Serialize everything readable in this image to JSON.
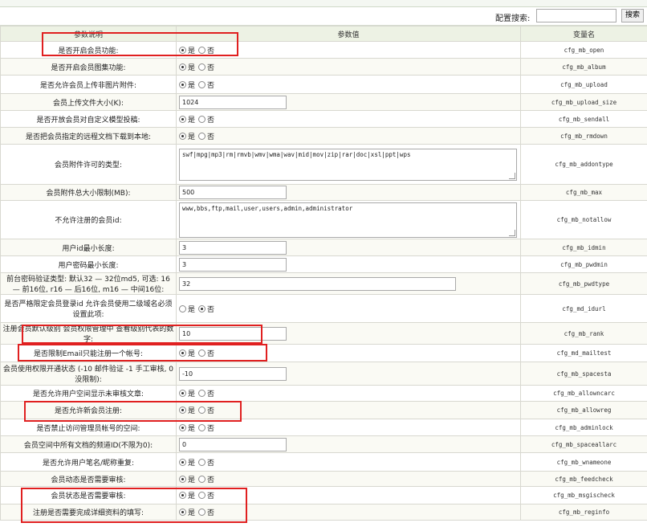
{
  "search": {
    "label": "配置搜索:",
    "value": "",
    "button": "搜索"
  },
  "columns": {
    "desc": "参数说明",
    "value": "参数值",
    "name": "变量名"
  },
  "radio_labels": {
    "yes": "是",
    "no": "否"
  },
  "rows": [
    {
      "desc": "是否开启会员功能:",
      "type": "radio",
      "value": "yes",
      "var": "cfg_mb_open"
    },
    {
      "desc": "是否开启会员图集功能:",
      "type": "radio",
      "value": "yes",
      "var": "cfg_mb_album"
    },
    {
      "desc": "是否允许会员上传非图片附件:",
      "type": "radio",
      "value": "yes",
      "var": "cfg_mb_upload"
    },
    {
      "desc": "会员上传文件大小(K):",
      "type": "text",
      "value": "1024",
      "var": "cfg_mb_upload_size"
    },
    {
      "desc": "是否开放会员对自定义模型投稿:",
      "type": "radio",
      "value": "yes",
      "var": "cfg_mb_sendall"
    },
    {
      "desc": "是否把会员指定的远程文档下载到本地:",
      "type": "radio",
      "value": "yes",
      "var": "cfg_mb_rmdown"
    },
    {
      "desc": "会员附件许可的类型:",
      "type": "textarea",
      "value": "swf|mpg|mp3|rm|rmvb|wmv|wma|wav|mid|mov|zip|rar|doc|xsl|ppt|wps",
      "var": "cfg_mb_addontype"
    },
    {
      "desc": "会员附件总大小限制(MB):",
      "type": "text",
      "value": "500",
      "var": "cfg_mb_max"
    },
    {
      "desc": "不允许注册的会员id:",
      "type": "textarea",
      "value": "www,bbs,ftp,mail,user,users,admin,administrator",
      "var": "cfg_mb_notallow"
    },
    {
      "desc": "用户id最小长度:",
      "type": "text",
      "value": "3",
      "var": "cfg_mb_idmin"
    },
    {
      "desc": "用户密码最小长度:",
      "type": "text",
      "value": "3",
      "var": "cfg_mb_pwdmin"
    },
    {
      "desc": "前台密码验证类型: 默认32 — 32位md5, 可选: 16 — 前16位, r16 — 后16位, m16 — 中间16位:",
      "type": "textwide",
      "value": "32",
      "var": "cfg_mb_pwdtype"
    },
    {
      "desc": "是否严格限定会员登录id 允许会员使用二级域名必须设置此项:",
      "type": "radio",
      "value": "no",
      "var": "cfg_md_idurl"
    },
    {
      "desc": "注册会员默认级别 会员权限管理中 查看级别代表的数字:",
      "type": "text",
      "value": "10",
      "var": "cfg_mb_rank"
    },
    {
      "desc": "是否限制Email只能注册一个帐号:",
      "type": "radio",
      "value": "yes",
      "var": "cfg_md_mailtest"
    },
    {
      "desc": "会员使用权限开通状态 (-10 邮件验证 -1 手工审核, 0 没限制):",
      "type": "text",
      "value": "-10",
      "var": "cfg_mb_spacesta"
    },
    {
      "desc": "是否允许用户空间显示未审核文章:",
      "type": "radio",
      "value": "yes",
      "var": "cfg_mb_allowncarc"
    },
    {
      "desc": "是否允许新会员注册:",
      "type": "radio",
      "value": "yes",
      "var": "cfg_mb_allowreg"
    },
    {
      "desc": "是否禁止访问管理员帐号的空间:",
      "type": "radio",
      "value": "yes",
      "var": "cfg_mb_adminlock"
    },
    {
      "desc": "会员空间中所有文档的频道ID(不限为0):",
      "type": "text",
      "value": "0",
      "var": "cfg_mb_spaceallarc"
    },
    {
      "desc": "是否允许用户笔名/昵称重复:",
      "type": "radio",
      "value": "yes",
      "var": "cfg_mb_wnameone"
    },
    {
      "desc": "会员动态是否需要审核:",
      "type": "radio",
      "value": "yes",
      "var": "cfg_mb_feedcheck"
    },
    {
      "desc": "会员状态是否需要审核:",
      "type": "radio",
      "value": "yes",
      "var": "cfg_mb_msgischeck"
    },
    {
      "desc": "注册是否需要完成详细资料的填写:",
      "type": "radio",
      "value": "yes",
      "var": "cfg_mb_reginfo"
    }
  ],
  "colors": {
    "header_bg": "#edf2e4",
    "border": "#d8d8d0",
    "highlight": "#e02020"
  }
}
